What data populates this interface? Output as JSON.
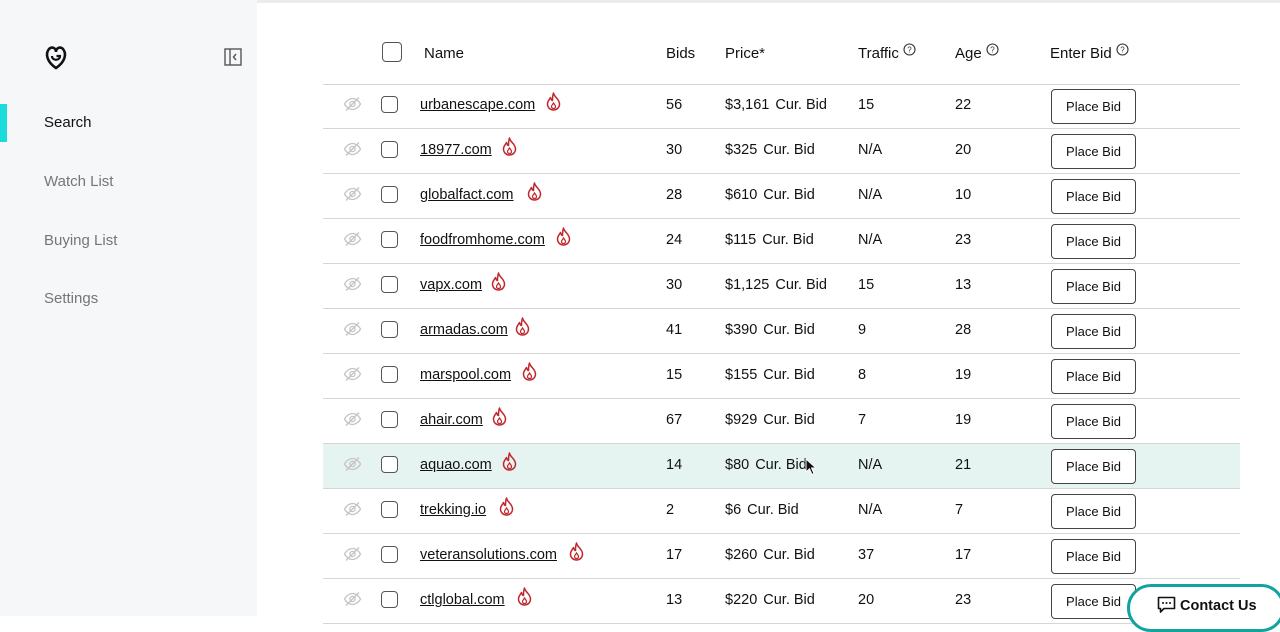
{
  "sidebar": {
    "logo_icon": "godaddy-logo",
    "items": [
      {
        "label": "Search",
        "active": true
      },
      {
        "label": "Watch List",
        "active": false
      },
      {
        "label": "Buying List",
        "active": false
      },
      {
        "label": "Settings",
        "active": false
      }
    ],
    "accent_color": "#1bdbdb"
  },
  "table": {
    "headers": {
      "name": "Name",
      "bids": "Bids",
      "price": "Price*",
      "traffic": "Traffic",
      "age": "Age",
      "enter_bid": "Enter Bid"
    },
    "rows": [
      {
        "domain": "urbanescape.com",
        "bids": "56",
        "price": "$3,161",
        "price_note": "Cur. Bid",
        "traffic": "15",
        "age": "22",
        "action": "Place Bid"
      },
      {
        "domain": "18977.com",
        "bids": "30",
        "price": "$325",
        "price_note": "Cur. Bid",
        "traffic": "N/A",
        "age": "20",
        "action": "Place Bid"
      },
      {
        "domain": "globalfact.com",
        "bids": "28",
        "price": "$610",
        "price_note": "Cur. Bid",
        "traffic": "N/A",
        "age": "10",
        "action": "Place Bid"
      },
      {
        "domain": "foodfromhome.com",
        "bids": "24",
        "price": "$115",
        "price_note": "Cur. Bid",
        "traffic": "N/A",
        "age": "23",
        "action": "Place Bid"
      },
      {
        "domain": "vapx.com",
        "bids": "30",
        "price": "$1,125",
        "price_note": "Cur. Bid",
        "traffic": "15",
        "age": "13",
        "action": "Place Bid"
      },
      {
        "domain": "armadas.com",
        "bids": "41",
        "price": "$390",
        "price_note": "Cur. Bid",
        "traffic": "9",
        "age": "28",
        "action": "Place Bid"
      },
      {
        "domain": "marspool.com",
        "bids": "15",
        "price": "$155",
        "price_note": "Cur. Bid",
        "traffic": "8",
        "age": "19",
        "action": "Place Bid"
      },
      {
        "domain": "ahair.com",
        "bids": "67",
        "price": "$929",
        "price_note": "Cur. Bid",
        "traffic": "7",
        "age": "19",
        "action": "Place Bid"
      },
      {
        "domain": "aquao.com",
        "bids": "14",
        "price": "$80",
        "price_note": "Cur. Bid",
        "traffic": "N/A",
        "age": "21",
        "action": "Place Bid",
        "highlighted": true
      },
      {
        "domain": "trekking.io",
        "bids": "2",
        "price": "$6",
        "price_note": "Cur. Bid",
        "traffic": "N/A",
        "age": "7",
        "action": "Place Bid"
      },
      {
        "domain": "veteransolutions.com",
        "bids": "17",
        "price": "$260",
        "price_note": "Cur. Bid",
        "traffic": "37",
        "age": "17",
        "action": "Place Bid"
      },
      {
        "domain": "ctlglobal.com",
        "bids": "13",
        "price": "$220",
        "price_note": "Cur. Bid",
        "traffic": "20",
        "age": "23",
        "action": "Place Bid"
      }
    ],
    "row_icons": {
      "hide": "eye-slash-icon",
      "hot": "flame-icon"
    },
    "hot_color": "#c0272d",
    "highlight_color": "#e6f4f1"
  },
  "contact": {
    "label": "Contact Us",
    "icon": "chat-icon",
    "border_color": "#12a3a1"
  }
}
